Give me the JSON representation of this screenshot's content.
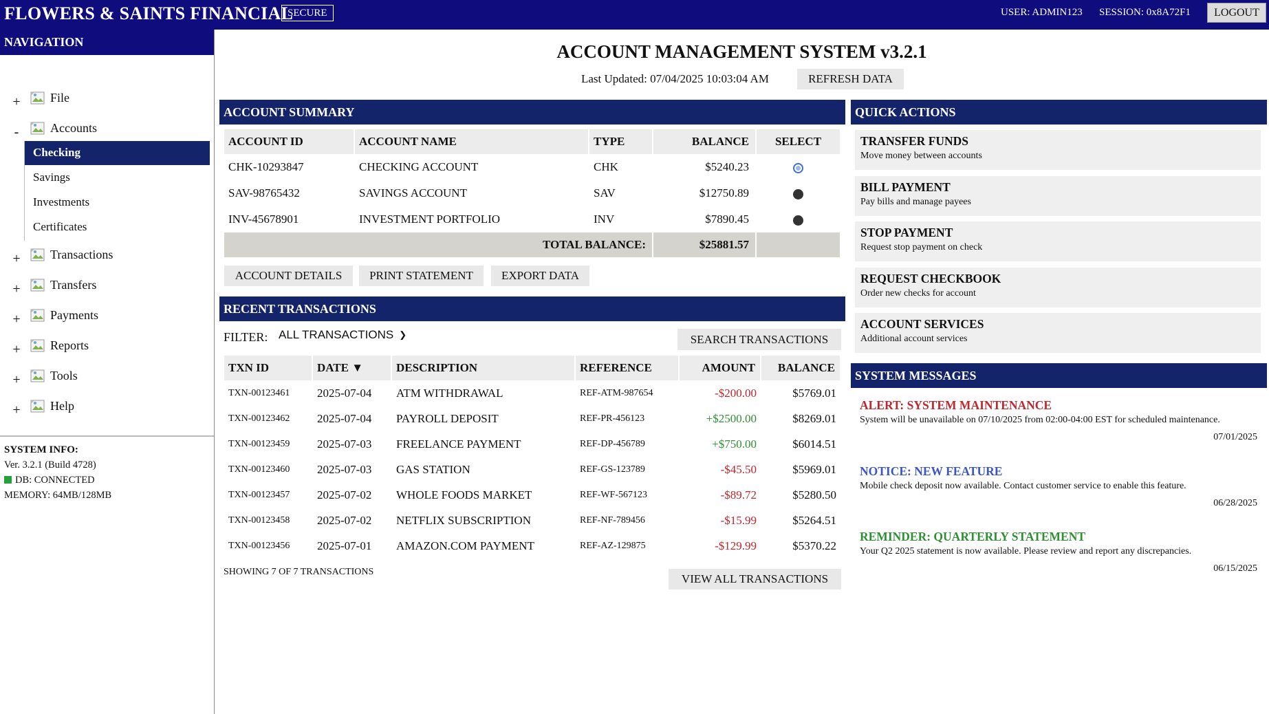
{
  "header": {
    "brand": "FLOWERS & SAINTS FINANCIAL",
    "secure_badge": "SECURE",
    "user": "USER: ADMIN123",
    "session": "SESSION: 0x8A72F1",
    "logout_label": "LOGOUT"
  },
  "sidebar": {
    "title": "NAVIGATION",
    "nodes": [
      {
        "toggle": "+",
        "label": "File"
      },
      {
        "toggle": "-",
        "label": "Accounts"
      },
      {
        "toggle": "+",
        "label": "Transactions"
      },
      {
        "toggle": "+",
        "label": "Transfers"
      },
      {
        "toggle": "+",
        "label": "Payments"
      },
      {
        "toggle": "+",
        "label": "Reports"
      },
      {
        "toggle": "+",
        "label": "Tools"
      },
      {
        "toggle": "+",
        "label": "Help"
      }
    ],
    "account_children": [
      "Checking",
      "Savings",
      "Investments",
      "Certificates"
    ],
    "active_child": "Checking",
    "system_info": {
      "title": "SYSTEM INFO:",
      "version": "Ver. 3.2.1 (Build 4728)",
      "db_status": "DB: CONNECTED",
      "memory": "MEMORY: 64MB/128MB",
      "db_color": "#22a33a"
    }
  },
  "main": {
    "title": "ACCOUNT MANAGEMENT SYSTEM v3.2.1",
    "last_updated": "Last Updated: 07/04/2025 10:03:04 AM",
    "refresh_label": "REFRESH DATA"
  },
  "account_summary": {
    "title": "ACCOUNT SUMMARY",
    "columns": [
      "ACCOUNT ID",
      "ACCOUNT NAME",
      "TYPE",
      "BALANCE",
      "SELECT"
    ],
    "rows": [
      {
        "id": "CHK-10293847",
        "name": "CHECKING ACCOUNT",
        "type": "CHK",
        "balance": "$5240.23",
        "selected": true
      },
      {
        "id": "SAV-98765432",
        "name": "SAVINGS ACCOUNT",
        "type": "SAV",
        "balance": "$12750.89",
        "selected": false
      },
      {
        "id": "INV-45678901",
        "name": "INVESTMENT PORTFOLIO",
        "type": "INV",
        "balance": "$7890.45",
        "selected": false
      }
    ],
    "total_label": "TOTAL BALANCE:",
    "total_value": "$25881.57",
    "actions": [
      "ACCOUNT DETAILS",
      "PRINT STATEMENT",
      "EXPORT DATA"
    ]
  },
  "transactions": {
    "title": "RECENT TRANSACTIONS",
    "filter_label": "FILTER:",
    "filter_value": "ALL TRANSACTIONS",
    "search_label": "SEARCH TRANSACTIONS",
    "columns": [
      "TXN ID",
      "DATE ▼",
      "DESCRIPTION",
      "REFERENCE",
      "AMOUNT",
      "BALANCE"
    ],
    "rows": [
      {
        "id": "TXN-00123461",
        "date": "2025-07-04",
        "desc": "ATM WITHDRAWAL",
        "ref": "REF-ATM-987654",
        "amount": "-$200.00",
        "balance": "$5769.01"
      },
      {
        "id": "TXN-00123462",
        "date": "2025-07-04",
        "desc": "PAYROLL DEPOSIT",
        "ref": "REF-PR-456123",
        "amount": "+$2500.00",
        "balance": "$8269.01"
      },
      {
        "id": "TXN-00123459",
        "date": "2025-07-03",
        "desc": "FREELANCE PAYMENT",
        "ref": "REF-DP-456789",
        "amount": "+$750.00",
        "balance": "$6014.51"
      },
      {
        "id": "TXN-00123460",
        "date": "2025-07-03",
        "desc": "GAS STATION",
        "ref": "REF-GS-123789",
        "amount": "-$45.50",
        "balance": "$5969.01"
      },
      {
        "id": "TXN-00123457",
        "date": "2025-07-02",
        "desc": "WHOLE FOODS MARKET",
        "ref": "REF-WF-567123",
        "amount": "-$89.72",
        "balance": "$5280.50"
      },
      {
        "id": "TXN-00123458",
        "date": "2025-07-02",
        "desc": "NETFLIX SUBSCRIPTION",
        "ref": "REF-NF-789456",
        "amount": "-$15.99",
        "balance": "$5264.51"
      },
      {
        "id": "TXN-00123456",
        "date": "2025-07-01",
        "desc": "AMAZON.COM PAYMENT",
        "ref": "REF-AZ-129875",
        "amount": "-$129.99",
        "balance": "$5370.22"
      }
    ],
    "showing": "SHOWING 7 OF 7 TRANSACTIONS",
    "view_all_label": "VIEW ALL TRANSACTIONS"
  },
  "quick_actions": {
    "title": "QUICK ACTIONS",
    "items": [
      {
        "title": "TRANSFER FUNDS",
        "desc": "Move money between accounts"
      },
      {
        "title": "BILL PAYMENT",
        "desc": "Pay bills and manage payees"
      },
      {
        "title": "STOP PAYMENT",
        "desc": "Request stop payment on check"
      },
      {
        "title": "REQUEST CHECKBOOK",
        "desc": "Order new checks for account"
      },
      {
        "title": "ACCOUNT SERVICES",
        "desc": "Additional account services"
      }
    ]
  },
  "system_messages": {
    "title": "SYSTEM MESSAGES",
    "items": [
      {
        "title": "ALERT: SYSTEM MAINTENANCE",
        "body": "System will be unavailable on 07/10/2025 from 02:00-04:00 EST for scheduled maintenance.",
        "date": "07/01/2025",
        "color": "#c0262b"
      },
      {
        "title": "NOTICE: NEW FEATURE",
        "body": "Mobile check deposit now available. Contact customer service to enable this feature.",
        "date": "06/28/2025",
        "color": "#3a55c9"
      },
      {
        "title": "REMINDER: QUARTERLY STATEMENT",
        "body": "Your Q2 2025 statement is now available. Please review and report any discrepancies.",
        "date": "06/15/2025",
        "color": "#2f8f33"
      }
    ]
  },
  "colors": {
    "topbar": "#0f0c7e",
    "panel_header": "#14246a",
    "negative": "#c0262b",
    "positive": "#2f8f33"
  }
}
